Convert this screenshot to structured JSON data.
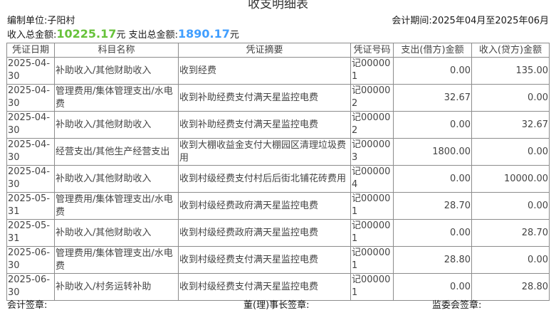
{
  "title": "收支明细表",
  "header": {
    "unit": "编制单位:子阳村",
    "period": "会计期间:2025年04月至2025年06月"
  },
  "totals": {
    "income_label": "收入总金额:",
    "income_value": "10225.17",
    "income_unit": "元",
    "expense_label": "支出总金额:",
    "expense_value": "1890.17",
    "expense_unit": "元",
    "income_color": "#67c23a",
    "expense_color": "#409eff"
  },
  "table": {
    "columns": [
      "凭证日期",
      "科目名称",
      "凭证摘要",
      "凭证号码",
      "支出(借方)金额",
      "收入(贷方)金额"
    ],
    "rows": [
      [
        "2025-04-30",
        "补助收入/其他财助收入",
        "收到经费",
        "记000001",
        "0.00",
        "135.00"
      ],
      [
        "2025-04-30",
        "管理费用/集体管理支出/水电费",
        "收到补助经费支付满天星监控电费",
        "记000002",
        "32.67",
        "0.00"
      ],
      [
        "2025-04-30",
        "补助收入/其他财助收入",
        "收到补助经费支付满天星监控电费",
        "记000002",
        "0.00",
        "32.67"
      ],
      [
        "2025-04-30",
        "经营支出/其他生产经营支出",
        "收到大棚收益金支付大棚园区清理垃圾费用",
        "记000003",
        "1800.00",
        "0.00"
      ],
      [
        "2025-04-30",
        "补助收入/其他财助收入",
        "收到村级经费支付村后后街北铺花砖费用",
        "记000004",
        "0.00",
        "10000.00"
      ],
      [
        "2025-05-31",
        "管理费用/集体管理支出/水电费",
        "收到村级经费政府满天星监控电费",
        "记000001",
        "28.70",
        "0.00"
      ],
      [
        "2025-05-31",
        "补助收入/其他财助收入",
        "收到村级经费政府满天星监控电费",
        "记000001",
        "0.00",
        "28.70"
      ],
      [
        "2025-06-30",
        "管理费用/集体管理支出/水电费",
        "收到村级经费支付满天星监控电费",
        "记000001",
        "28.80",
        "0.00"
      ],
      [
        "2025-06-30",
        "补助收入/村务运转补助",
        "收到村级经费支付满天星监控电费",
        "记000001",
        "0.00",
        "28.80"
      ]
    ]
  },
  "footer": {
    "accountant": "会计签章:",
    "chairman": "董(理)事长签章:",
    "supervisor": "监委会签章:"
  }
}
